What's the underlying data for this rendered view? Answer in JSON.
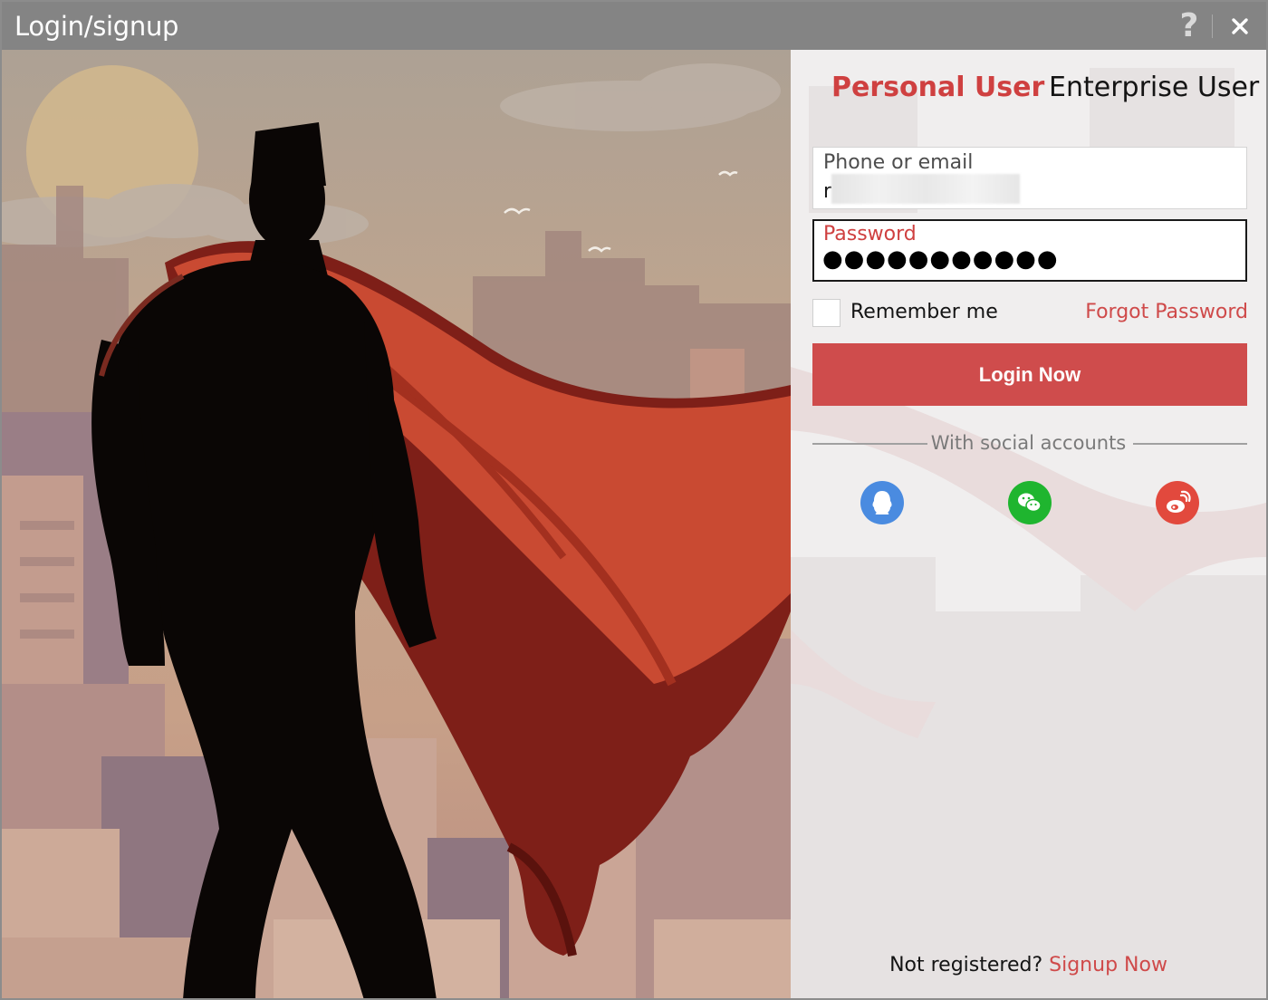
{
  "window": {
    "title": "Login/signup",
    "help_glyph": "?",
    "controls": {
      "help_icon": "question-mark-icon",
      "close_icon": "close-icon"
    }
  },
  "hero": {
    "icons": [
      "superhero-silhouette",
      "city-skyline",
      "sun",
      "birds"
    ]
  },
  "tabs": [
    {
      "label": "Personal User",
      "selected": true
    },
    {
      "label": "Enterprise User",
      "selected": false
    }
  ],
  "login_form": {
    "account_field": {
      "label": "Phone or email",
      "value": "r"
    },
    "password_field": {
      "label": "Password",
      "value": "●●●●●●●●●●●",
      "focused": true
    },
    "remember_me": {
      "label": "Remember me",
      "checked": false
    },
    "forgot_password": "Forgot Password",
    "login_button": "Login Now"
  },
  "social": {
    "divider_text": "With social accounts",
    "providers": [
      {
        "icon": "qq-icon",
        "color": "#4a8be0"
      },
      {
        "icon": "wechat-icon",
        "color": "#1fb52f"
      },
      {
        "icon": "weibo-icon",
        "color": "#e2493d"
      }
    ]
  },
  "footer": {
    "not_registered": "Not registered?",
    "signup_link": "Signup Now"
  },
  "colors": {
    "accent": "#cf4c4c",
    "titlebar": "#848484",
    "panel_bg": "#f0eeee"
  }
}
